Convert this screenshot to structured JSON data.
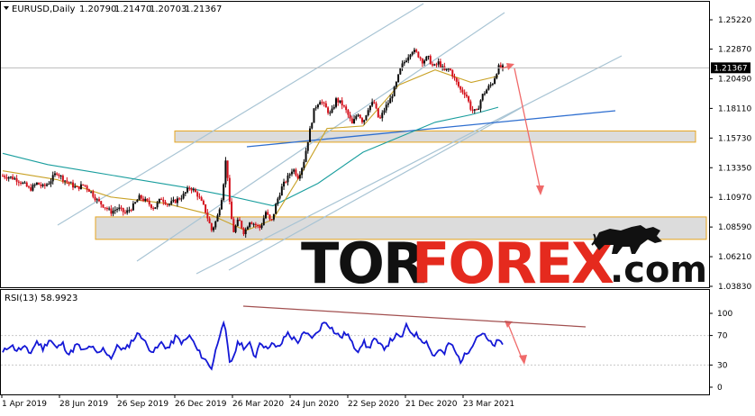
{
  "chart_data": [
    {
      "type": "line",
      "symbol": "EURUSD",
      "timeframe": "Daily",
      "ohlc": [
        "1.20790",
        "1.21470",
        "1.20703",
        "1.21367"
      ],
      "current_price": "1.21367",
      "y_ticks": [
        "1.25220",
        "1.22870",
        "1.20490",
        "1.18110",
        "1.15730",
        "1.13350",
        "1.10970",
        "1.08590",
        "1.06210",
        "1.03830"
      ],
      "ylim": [
        1.0383,
        1.2522
      ],
      "x_ticks": [
        "1 Apr 2019",
        "28 Jun 2019",
        "26 Sep 2019",
        "26 Dec 2019",
        "26 Mar 2020",
        "24 Jun 2020",
        "22 Sep 2020",
        "21 Dec 2020",
        "23 Mar 2021"
      ],
      "support_zones": [
        [
          1.154,
          1.163
        ],
        [
          1.076,
          1.094
        ]
      ],
      "price_series": [
        {
          "name": "close",
          "x": [
            0,
            8,
            16,
            24,
            30,
            38,
            45,
            52,
            60,
            66,
            74,
            82,
            90,
            98,
            105,
            112,
            120,
            128,
            136,
            144,
            152,
            160,
            168,
            176,
            184,
            192,
            200,
            208,
            216,
            224,
            232,
            238,
            244,
            248,
            252,
            256,
            262,
            268,
            274,
            280,
            286,
            292,
            298,
            304,
            310,
            316,
            322,
            328,
            334,
            340,
            346,
            352,
            358,
            364,
            370,
            376,
            382,
            388,
            394,
            400,
            406,
            412,
            418,
            424,
            430,
            436,
            442,
            448,
            454,
            460,
            466,
            472,
            478,
            484,
            490,
            496,
            502,
            508,
            514,
            520,
            526,
            532,
            538,
            544,
            550,
            555
          ],
          "values": [
            1.127,
            1.126,
            1.124,
            1.12,
            1.116,
            1.121,
            1.118,
            1.122,
            1.13,
            1.125,
            1.121,
            1.117,
            1.12,
            1.114,
            1.107,
            1.103,
            1.098,
            1.101,
            1.097,
            1.102,
            1.11,
            1.106,
            1.101,
            1.109,
            1.104,
            1.107,
            1.111,
            1.118,
            1.112,
            1.101,
            1.083,
            1.093,
            1.113,
            1.143,
            1.103,
            1.082,
            1.092,
            1.081,
            1.091,
            1.088,
            1.085,
            1.098,
            1.089,
            1.106,
            1.118,
            1.125,
            1.133,
            1.126,
            1.138,
            1.16,
            1.181,
            1.188,
            1.182,
            1.176,
            1.188,
            1.185,
            1.178,
            1.168,
            1.178,
            1.17,
            1.182,
            1.186,
            1.171,
            1.181,
            1.188,
            1.199,
            1.214,
            1.221,
            1.228,
            1.225,
            1.219,
            1.222,
            1.214,
            1.218,
            1.211,
            1.213,
            1.204,
            1.196,
            1.193,
            1.18,
            1.178,
            1.191,
            1.197,
            1.202,
            1.214,
            1.2137
          ]
        },
        {
          "name": "ma-slow",
          "x": [
            0,
            50,
            100,
            150,
            200,
            250,
            300,
            350,
            400,
            440,
            480,
            520,
            550
          ],
          "values": [
            1.145,
            1.136,
            1.13,
            1.124,
            1.118,
            1.111,
            1.103,
            1.121,
            1.146,
            1.158,
            1.17,
            1.176,
            1.182
          ]
        },
        {
          "name": "ma-fast",
          "x": [
            0,
            60,
            120,
            180,
            230,
            270,
            300,
            330,
            360,
            400,
            440,
            480,
            520,
            550
          ],
          "values": [
            1.131,
            1.124,
            1.11,
            1.105,
            1.096,
            1.083,
            1.092,
            1.127,
            1.165,
            1.167,
            1.2,
            1.212,
            1.202,
            1.207
          ]
        }
      ]
    },
    {
      "type": "line",
      "title": "RSI(13) 58.9923",
      "y_ticks": [
        "100",
        "70",
        "30",
        "0"
      ],
      "ylim": [
        0,
        100
      ],
      "series": [
        {
          "x": [
            0,
            8,
            16,
            24,
            30,
            38,
            45,
            52,
            60,
            66,
            74,
            82,
            90,
            98,
            105,
            112,
            120,
            128,
            136,
            144,
            152,
            160,
            168,
            176,
            184,
            192,
            200,
            208,
            216,
            224,
            232,
            238,
            244,
            248,
            252,
            256,
            262,
            268,
            274,
            280,
            286,
            292,
            298,
            304,
            310,
            316,
            322,
            328,
            334,
            340,
            346,
            352,
            358,
            364,
            370,
            376,
            382,
            388,
            394,
            400,
            406,
            412,
            418,
            424,
            430,
            436,
            442,
            448,
            454,
            460,
            466,
            472,
            478,
            484,
            490,
            496,
            502,
            508,
            514,
            520,
            526,
            532,
            538,
            544,
            550,
            555
          ],
          "values": [
            46,
            58,
            50,
            54,
            45,
            62,
            52,
            66,
            52,
            60,
            44,
            58,
            48,
            56,
            44,
            52,
            40,
            56,
            50,
            64,
            74,
            56,
            48,
            60,
            52,
            68,
            60,
            70,
            50,
            38,
            26,
            58,
            88,
            72,
            30,
            42,
            62,
            54,
            58,
            40,
            64,
            52,
            60,
            52,
            60,
            74,
            66,
            62,
            72,
            70,
            68,
            80,
            90,
            82,
            72,
            68,
            74,
            58,
            50,
            62,
            52,
            66,
            56,
            54,
            62,
            70,
            66,
            82,
            74,
            70,
            64,
            60,
            40,
            52,
            44,
            62,
            48,
            36,
            44,
            56,
            68,
            74,
            64,
            56,
            62,
            58.99
          ]
        }
      ]
    }
  ],
  "brand": {
    "part1": "TOR",
    "part2": "FOREX",
    "part3": ".com"
  },
  "colors": {
    "candle_up": "#0b0b0b",
    "candle_down": "#d40f1a",
    "ma_slow": "#1a9e9e",
    "ma_fast": "#c9a227",
    "trend_channel": "#a8c4d4",
    "trend_line": "#2f6fd0",
    "rsi_line": "#1418d6",
    "rsi_trend": "#a25050",
    "forecast_arrow": "#f06a6a",
    "zone_fill": "#d8d8d8",
    "zone_border": "#e6a51f"
  }
}
